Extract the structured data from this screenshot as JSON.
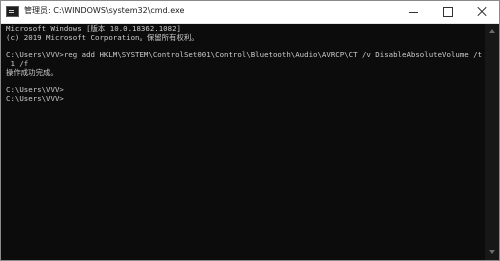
{
  "window": {
    "title": "管理员: C:\\WINDOWS\\system32\\cmd.exe",
    "icon": "cmd-icon",
    "controls": {
      "minimize_icon": "minimize-icon",
      "maximize_icon": "maximize-icon",
      "close_icon": "close-icon"
    }
  },
  "console": {
    "lines": [
      "Microsoft Windows [版本 10.0.18362.1082]",
      "(c) 2019 Microsoft Corporation。保留所有权利。",
      "C:\\Users\\VVV>reg add HKLM\\SYSTEM\\ControlSet001\\Control\\Bluetooth\\Audio\\AVRCP\\CT /v DisableAbsoluteVolume /t REG_DWORD /d",
      " 1 /f",
      "操作成功完成。",
      "C:\\Users\\VVV>",
      "C:\\Users\\VVV>"
    ],
    "text_color": "#cccccc",
    "background_color": "#0c0c0c"
  }
}
